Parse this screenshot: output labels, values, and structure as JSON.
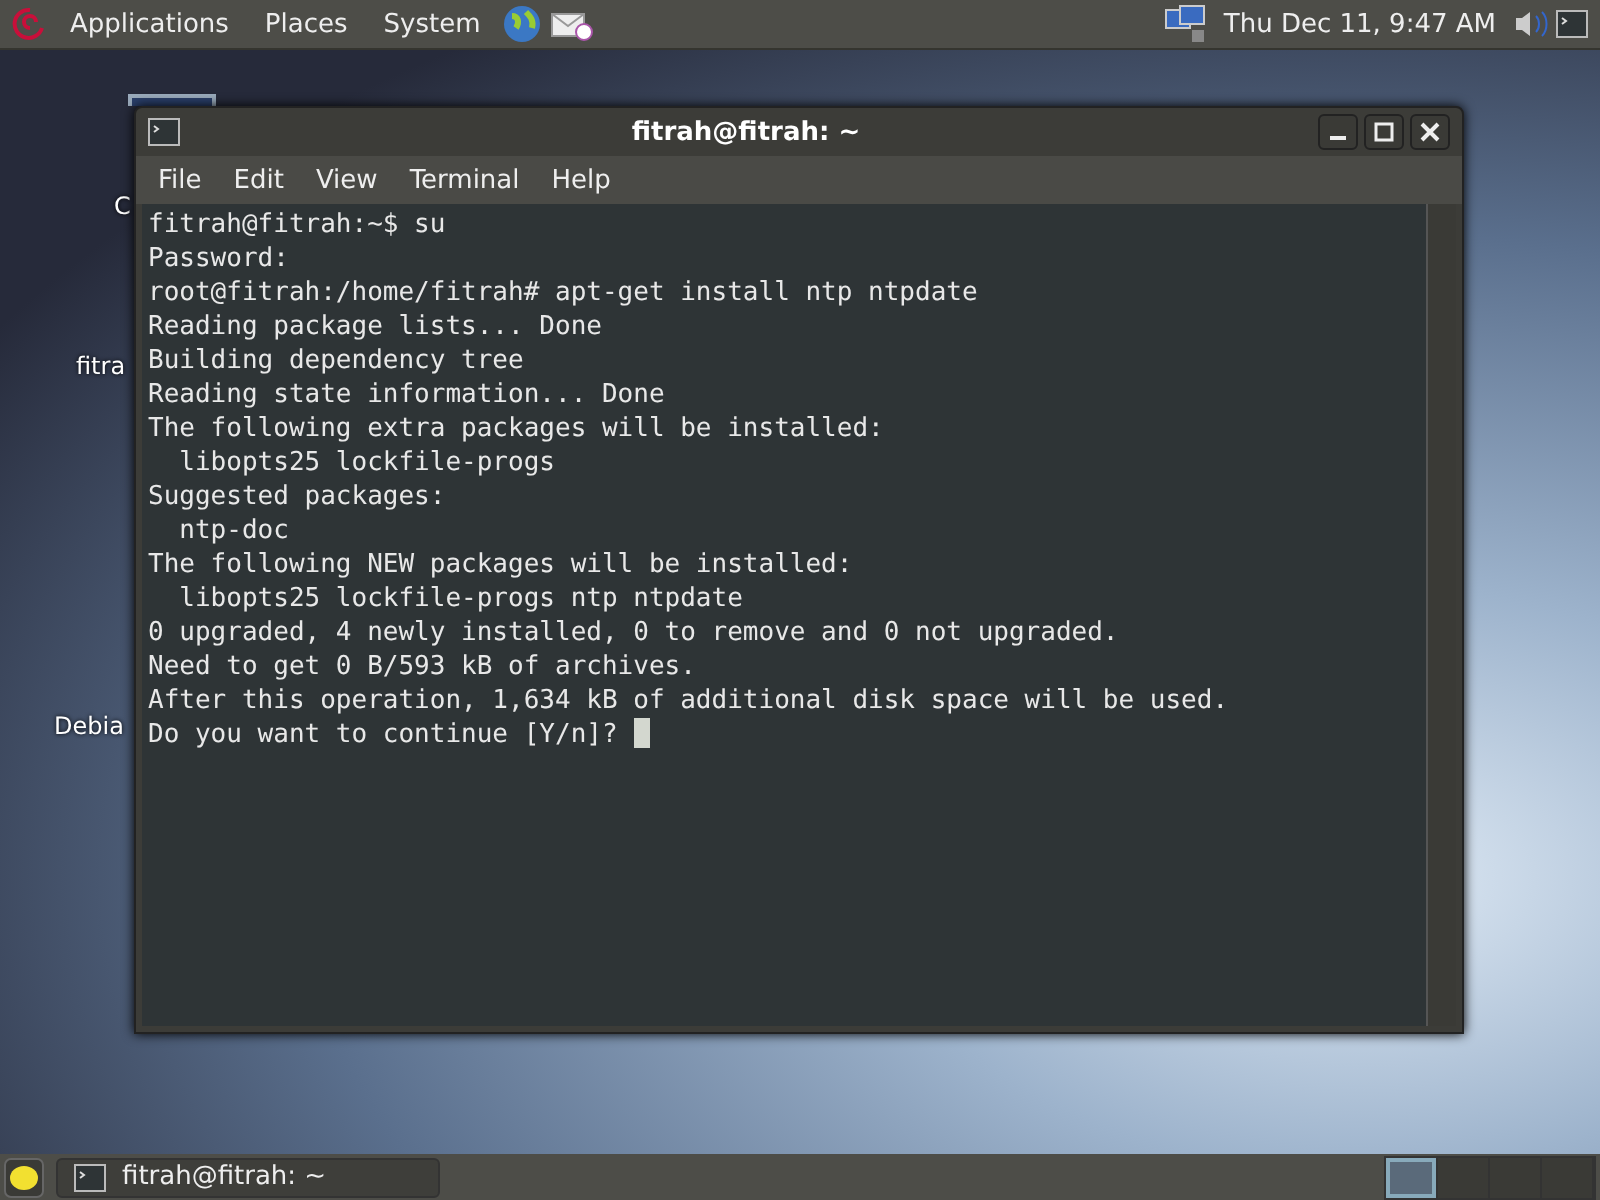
{
  "top_panel": {
    "menus": [
      "Applications",
      "Places",
      "System"
    ],
    "clock": "Thu Dec 11,  9:47 AM"
  },
  "desktop_icons": [
    "C",
    "fitra",
    "Debia"
  ],
  "window": {
    "title": "fitrah@fitrah: ~",
    "menu": [
      "File",
      "Edit",
      "View",
      "Terminal",
      "Help"
    ],
    "lines": [
      "fitrah@fitrah:~$ su",
      "Password:",
      "root@fitrah:/home/fitrah# apt-get install ntp ntpdate",
      "Reading package lists... Done",
      "Building dependency tree",
      "Reading state information... Done",
      "The following extra packages will be installed:",
      "  libopts25 lockfile-progs",
      "Suggested packages:",
      "  ntp-doc",
      "The following NEW packages will be installed:",
      "  libopts25 lockfile-progs ntp ntpdate",
      "0 upgraded, 4 newly installed, 0 to remove and 0 not upgraded.",
      "Need to get 0 B/593 kB of archives.",
      "After this operation, 1,634 kB of additional disk space will be used.",
      "Do you want to continue [Y/n]? "
    ],
    "cursor": true
  },
  "bottom_panel": {
    "tasks": [
      {
        "label": "fitrah@fitrah: ~",
        "selected": false
      }
    ],
    "workspaces": [
      {
        "selected": true
      },
      {
        "selected": false
      },
      {
        "selected": false
      },
      {
        "selected": false
      }
    ]
  }
}
